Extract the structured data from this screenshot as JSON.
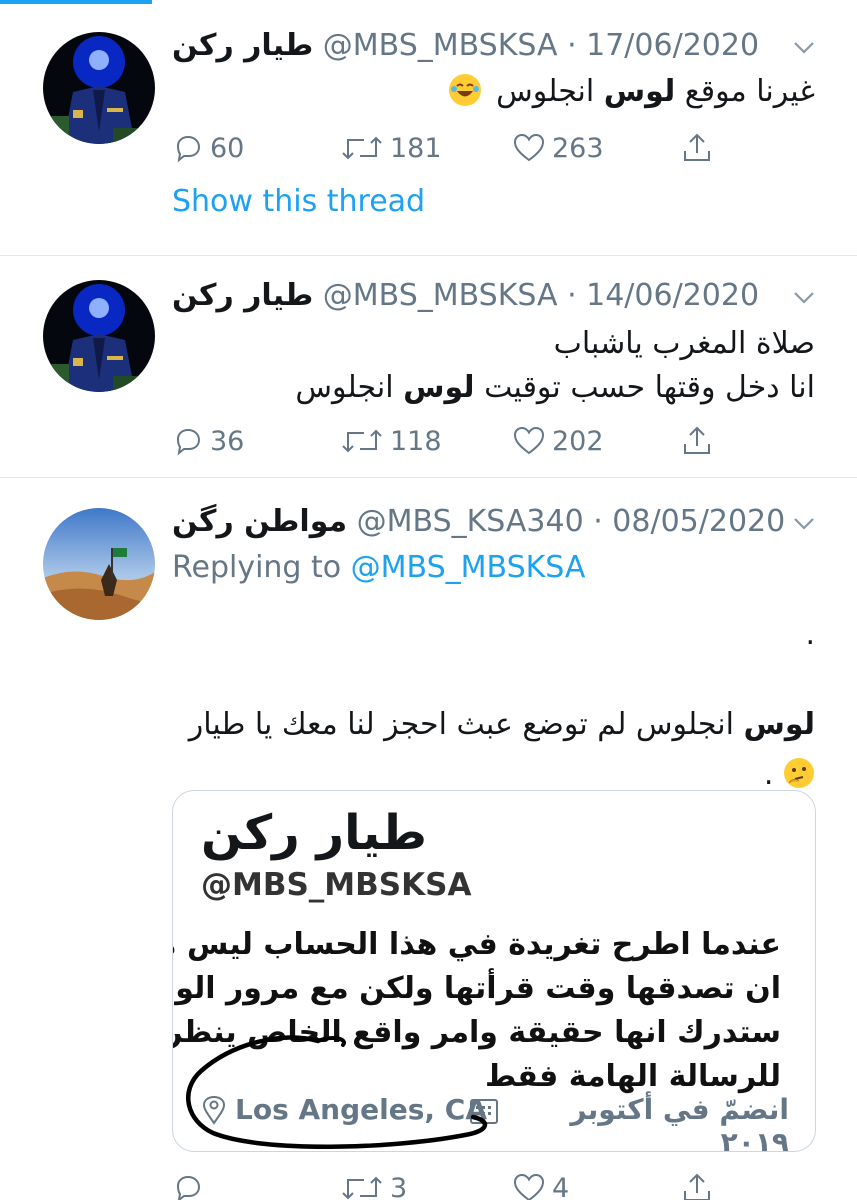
{
  "tweets": [
    {
      "name": "طيار ركن",
      "handle": "@MBS_MBSKSA",
      "date": "· 17/06/2020",
      "lines": [
        {
          "pre": "غيرنا موقع ",
          "bold": "لوس",
          "post": " انجلوس"
        }
      ],
      "stats": {
        "replies": "60",
        "retweets": "181",
        "likes": "263"
      },
      "show_thread": "Show this thread"
    },
    {
      "name": "طيار ركن",
      "handle": "@MBS_MBSKSA",
      "date": "· 14/06/2020",
      "lines": [
        {
          "pre": "صلاة المغرب ياشباب",
          "bold": "",
          "post": ""
        },
        {
          "pre": "انا دخل وقتها حسب توقيت ",
          "bold": "لوس",
          "post": " انجلوس"
        }
      ],
      "stats": {
        "replies": "36",
        "retweets": "118",
        "likes": "202"
      }
    },
    {
      "name": "مواطن رگن",
      "handle": "@MBS_KSA340",
      "date": "· 08/05/2020",
      "replying_prefix": "Replying to ",
      "replying_handle": "@MBS_MBSKSA",
      "lines": [
        {
          "pre": ".",
          "bold": "",
          "post": ""
        },
        {
          "pre": "",
          "bold": "لوس",
          "post": " انجلوس لم توضع عبث احجز لنا معك يا طيار"
        },
        {
          "pre": ".",
          "bold": "",
          "post": ""
        }
      ],
      "stats": {
        "replies": "",
        "retweets": "3",
        "likes": "4"
      },
      "card": {
        "name": "طيار ركن",
        "handle": "@MBS_MBSKSA",
        "bio_lines": [
          "عندما اطرح تغريدة في هذا الحساب ليس ملزم",
          "ان تصدقها وقت قرأتها ولكن مع مرور الوقت",
          "ستدرك انها حقيقة وامر واقع الخاص ينظر",
          "للرسالة الهامة فقط"
        ],
        "location": "Los Angeles, CA",
        "joined": "انضمّ في أكتوبر ٢٠١٩"
      }
    }
  ],
  "icons": {
    "reply": "reply-icon",
    "retweet": "retweet-icon",
    "like": "heart-icon",
    "share": "share-icon",
    "chevron": "chevron-down-icon",
    "location": "location-pin-icon",
    "calendar": "calendar-icon"
  },
  "colors": {
    "accent": "#1da1f2",
    "muted": "#657786",
    "border": "#e1e8ed"
  }
}
